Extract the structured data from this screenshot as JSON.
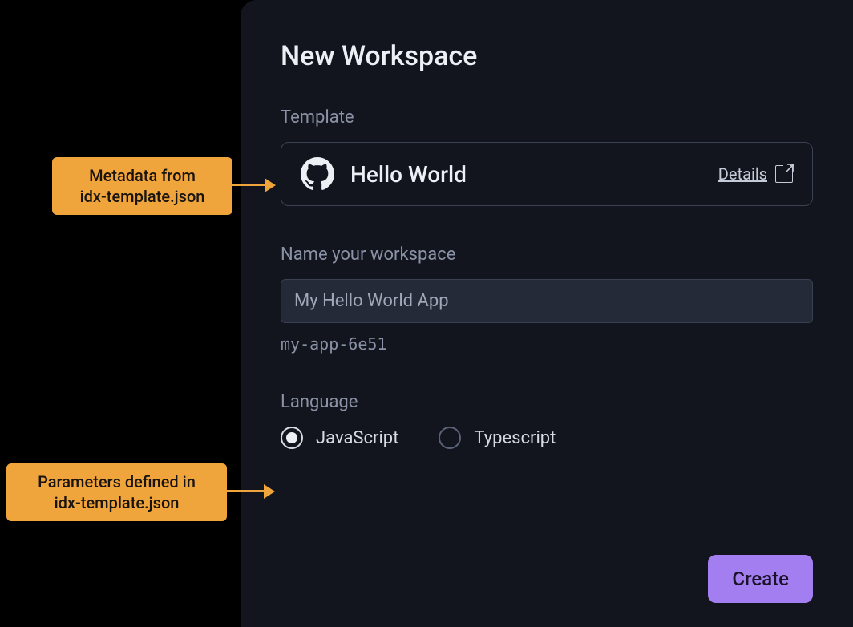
{
  "title": "New Workspace",
  "template": {
    "section_label": "Template",
    "name": "Hello World",
    "details_label": "Details",
    "icon": "github-icon"
  },
  "workspace_name": {
    "section_label": "Name your workspace",
    "value": "My Hello World App",
    "slug": "my-app-6e51"
  },
  "language": {
    "section_label": "Language",
    "options": [
      {
        "label": "JavaScript",
        "selected": true
      },
      {
        "label": "Typescript",
        "selected": false
      }
    ]
  },
  "create_button": "Create",
  "annotations": [
    {
      "line1": "Metadata from",
      "line2": "idx-template.json"
    },
    {
      "line1": "Parameters defined in",
      "line2": "idx-template.json"
    }
  ],
  "colors": {
    "panel_bg": "#12151e",
    "accent": "#a27ef0",
    "annotation_bg": "#f0a43c",
    "text_primary": "#eceff4",
    "text_secondary": "#8b92a5"
  }
}
